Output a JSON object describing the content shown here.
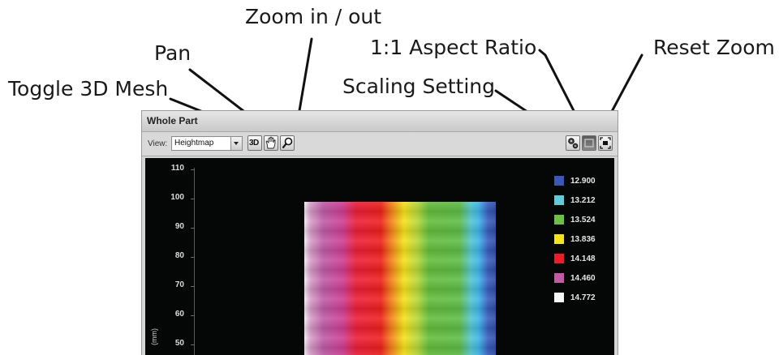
{
  "callouts": {
    "toggle_3d_mesh": "Toggle 3D Mesh",
    "pan": "Pan",
    "zoom": "Zoom in / out",
    "aspect_ratio": "1:1 Aspect Ratio",
    "reset_zoom": "Reset Zoom",
    "scaling_setting": "Scaling Setting"
  },
  "panel": {
    "title": "Whole Part",
    "view_label": "View:",
    "view_selected": "Heightmap",
    "btn_3d_label": "3D"
  },
  "plot": {
    "y_ticks": [
      "110",
      "100",
      "90",
      "80",
      "70",
      "60",
      "50"
    ],
    "y_axis_label": "(mm)",
    "legend": [
      {
        "label": "12.900",
        "color": "#3a58b5"
      },
      {
        "label": "13.212",
        "color": "#62cbd8"
      },
      {
        "label": "13.524",
        "color": "#6cc043"
      },
      {
        "label": "13.836",
        "color": "#f4e51a"
      },
      {
        "label": "14.148",
        "color": "#ee1c28"
      },
      {
        "label": "14.460",
        "color": "#c45aa6"
      },
      {
        "label": "14.772",
        "color": "#f7f7f7"
      }
    ]
  },
  "icons": {
    "pan": "hand-icon",
    "zoom": "magnifier-icon",
    "scaling": "gears-icon",
    "aspect": "aspect-ratio-icon",
    "reset": "reset-zoom-icon"
  }
}
